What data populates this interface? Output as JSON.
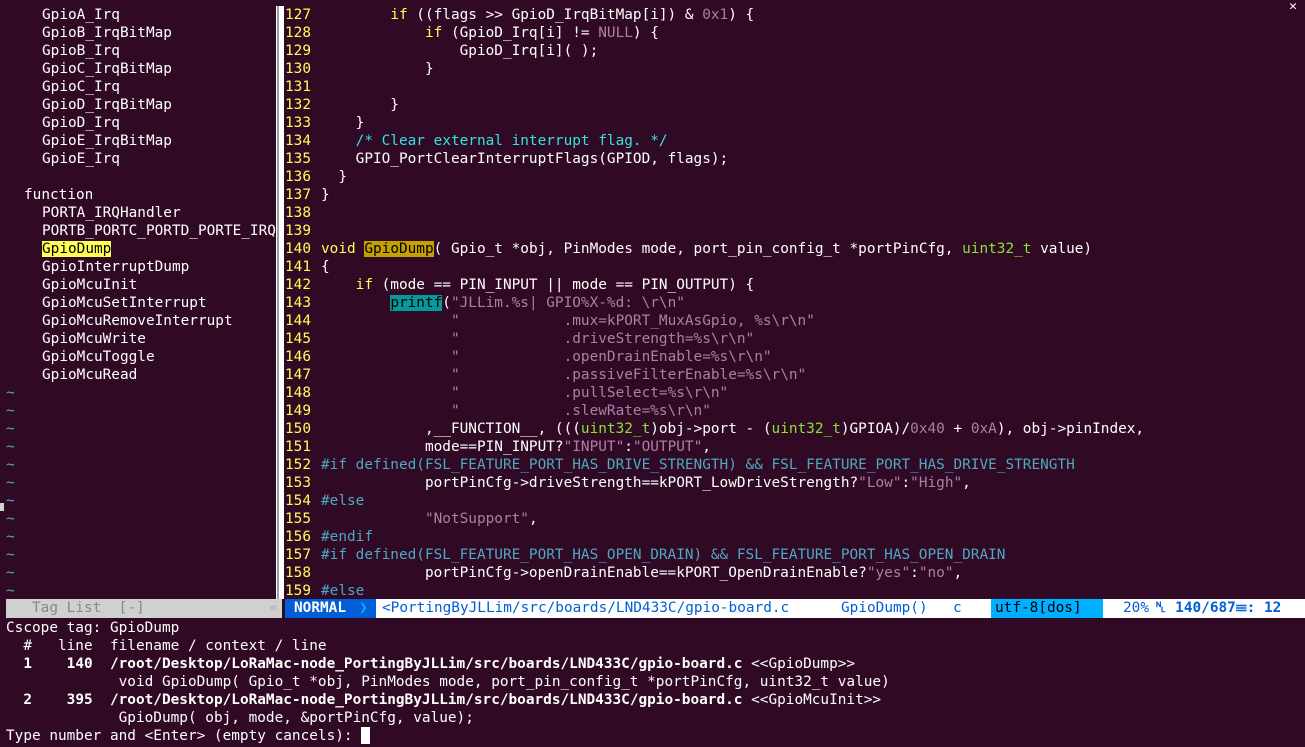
{
  "tagbar": {
    "items_top": [
      "GpioA_Irq",
      "GpioB_IrqBitMap",
      "GpioB_Irq",
      "GpioC_IrqBitMap",
      "GpioC_Irq",
      "GpioD_IrqBitMap",
      "GpioD_Irq",
      "GpioE_IrqBitMap",
      "GpioE_Irq"
    ],
    "kind_label": "function",
    "functions": [
      "PORTA_IRQHandler",
      "PORTB_PORTC_PORTD_PORTE_IRQHandler",
      "GpioDump",
      "GpioInterruptDump",
      "GpioMcuInit",
      "GpioMcuSetInterrupt",
      "GpioMcuRemoveInterrupt",
      "GpioMcuWrite",
      "GpioMcuToggle",
      "GpioMcuRead"
    ],
    "status_label": "Tag List  [-]",
    "status_arrow": "«"
  },
  "code": {
    "lines": [
      {
        "n": "127",
        "t": "        if ((flags >> GpioD_IrqBitMap[i]) & 0x1) {"
      },
      {
        "n": "128",
        "t": "            if (GpioD_Irq[i] != NULL) {"
      },
      {
        "n": "129",
        "t": "                GpioD_Irq[i]( );"
      },
      {
        "n": "130",
        "t": "            }"
      },
      {
        "n": "131",
        "t": ""
      },
      {
        "n": "132",
        "t": "        }"
      },
      {
        "n": "133",
        "t": "    }"
      },
      {
        "n": "134",
        "t": "    /* Clear external interrupt flag. */"
      },
      {
        "n": "135",
        "t": "    GPIO_PortClearInterruptFlags(GPIOD, flags);"
      },
      {
        "n": "136",
        "t": "  }"
      },
      {
        "n": "137",
        "t": "}"
      },
      {
        "n": "138",
        "t": ""
      },
      {
        "n": "139",
        "t": ""
      },
      {
        "n": "140",
        "t": "void GpioDump( Gpio_t *obj, PinModes mode, port_pin_config_t *portPinCfg, uint32_t value)"
      },
      {
        "n": "141",
        "t": "{"
      },
      {
        "n": "142",
        "t": "    if (mode == PIN_INPUT || mode == PIN_OUTPUT) {"
      },
      {
        "n": "143",
        "t": "        printf(\"JLLim.%s| GPIO%X-%d: \\r\\n\""
      },
      {
        "n": "144",
        "t": "               \"            .mux=kPORT_MuxAsGpio, %s\\r\\n\""
      },
      {
        "n": "145",
        "t": "               \"            .driveStrength=%s\\r\\n\""
      },
      {
        "n": "146",
        "t": "               \"            .openDrainEnable=%s\\r\\n\""
      },
      {
        "n": "147",
        "t": "               \"            .passiveFilterEnable=%s\\r\\n\""
      },
      {
        "n": "148",
        "t": "               \"            .pullSelect=%s\\r\\n\""
      },
      {
        "n": "149",
        "t": "               \"            .slewRate=%s\\r\\n\""
      },
      {
        "n": "150",
        "t": "            ,__FUNCTION__, (((uint32_t)obj->port - (uint32_t)GPIOA)/0x40 + 0xA), obj->pinIndex,"
      },
      {
        "n": "151",
        "t": "            mode==PIN_INPUT?\"INPUT\":\"OUTPUT\","
      },
      {
        "n": "152",
        "t": "#if defined(FSL_FEATURE_PORT_HAS_DRIVE_STRENGTH) && FSL_FEATURE_PORT_HAS_DRIVE_STRENGTH"
      },
      {
        "n": "153",
        "t": "            portPinCfg->driveStrength==kPORT_LowDriveStrength?\"Low\":\"High\","
      },
      {
        "n": "154",
        "t": "#else"
      },
      {
        "n": "155",
        "t": "            \"NotSupport\","
      },
      {
        "n": "156",
        "t": "#endif"
      },
      {
        "n": "157",
        "t": "#if defined(FSL_FEATURE_PORT_HAS_OPEN_DRAIN) && FSL_FEATURE_PORT_HAS_OPEN_DRAIN"
      },
      {
        "n": "158",
        "t": "            portPinCfg->openDrainEnable==kPORT_OpenDrainEnable?\"yes\":\"no\","
      },
      {
        "n": "159",
        "t": "#else"
      }
    ]
  },
  "status": {
    "mode": "NORMAL",
    "path": "<PortingByJLLim/src/boards/LND433C/gpio-board.c",
    "function": "GpioDump()",
    "filetype": "c",
    "encoding": "utf-8[dos]",
    "percent": "20%",
    "position": "␤ 140/687☰: 12"
  },
  "cscope": {
    "tag_line": "Cscope tag: GpioDump",
    "header": "  #   line  filename / context / line",
    "results": [
      {
        "num": "1",
        "line": "140",
        "file": "/root/Desktop/LoRaMac-node_PortingByJLLim/src/boards/LND433C/gpio-board.c",
        "tag": "<<GpioDump>>",
        "context": "void GpioDump( Gpio_t *obj, PinModes mode, port_pin_config_t *portPinCfg, uint32_t value)"
      },
      {
        "num": "2",
        "line": "395",
        "file": "/root/Desktop/LoRaMac-node_PortingByJLLim/src/boards/LND433C/gpio-board.c",
        "tag": "<<GpioMcuInit>>",
        "context": "GpioDump( obj, mode, &portPinCfg, value);"
      }
    ],
    "prompt": "Type number and <Enter> (empty cancels): "
  },
  "colors": {
    "background": "#300a24",
    "line_number": "#ffff55",
    "keyword": "#ffff55",
    "type": "#8ae234",
    "comment": "#34e2e2",
    "string": "#ad7fa8",
    "mode_bg": "#005fd7",
    "encoding_bg": "#00afff"
  }
}
